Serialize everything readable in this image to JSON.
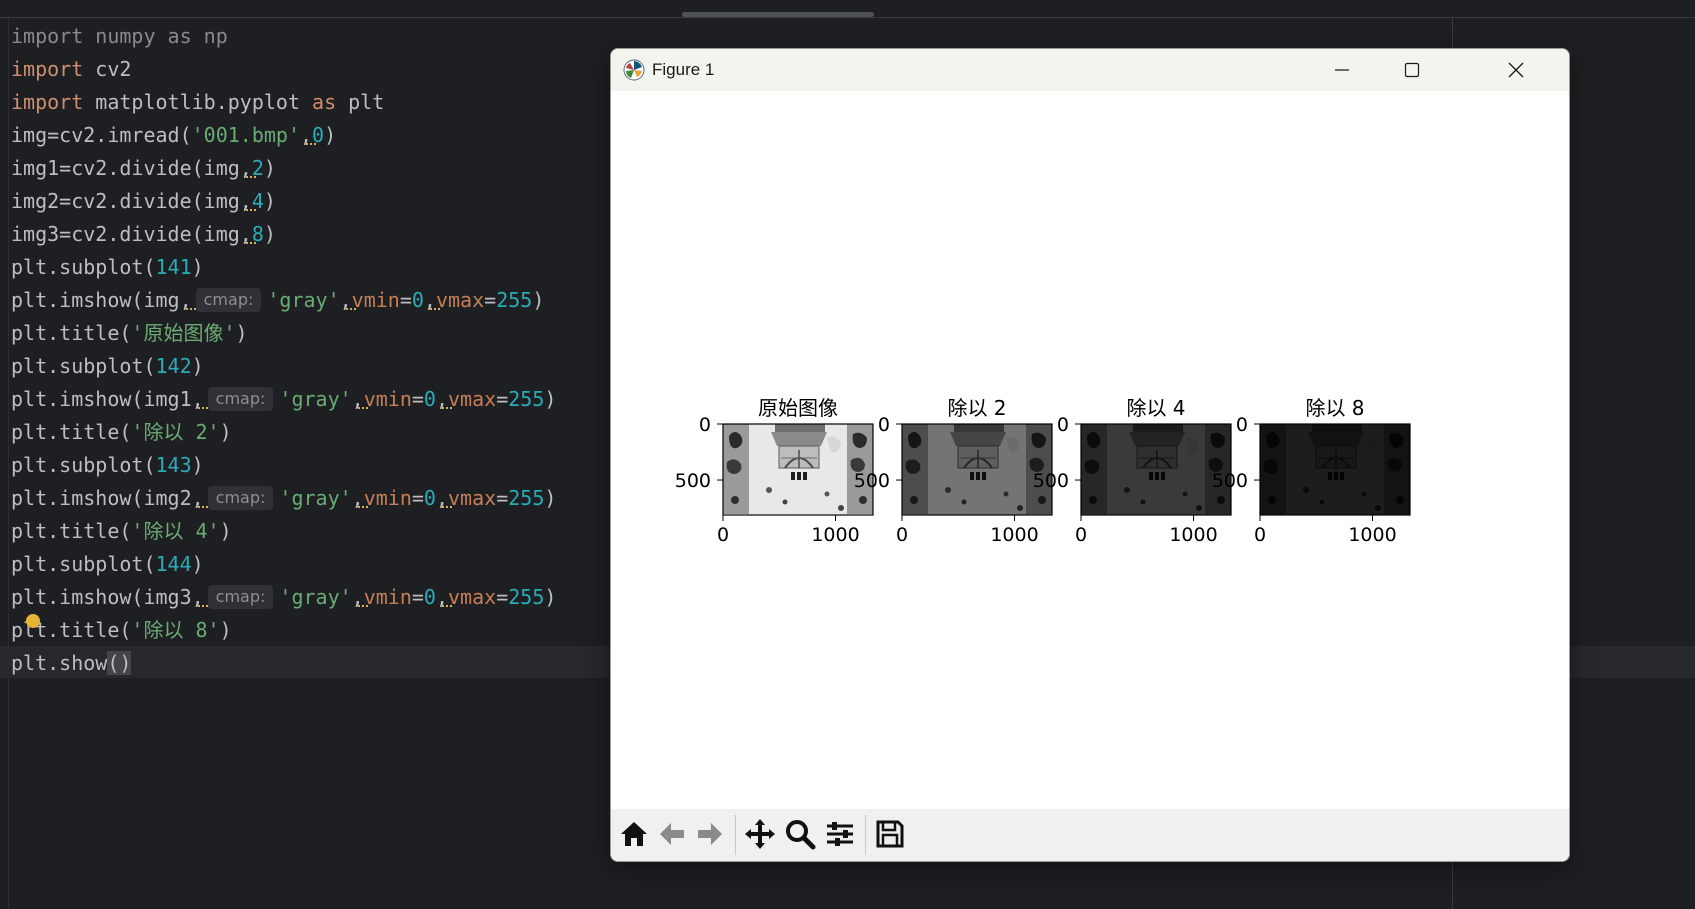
{
  "editor": {
    "lines": [
      [
        {
          "t": "import numpy as np",
          "c": "muted"
        }
      ],
      [
        {
          "t": "import",
          "c": "kw"
        },
        {
          "t": " cv2"
        }
      ],
      [
        {
          "t": "import",
          "c": "kw"
        },
        {
          "t": " matplotlib.pyplot "
        },
        {
          "t": "as",
          "c": "kw"
        },
        {
          "t": " plt"
        }
      ],
      [
        {
          "t": "img=cv2.imread("
        },
        {
          "t": "'001.bmp'",
          "c": "str"
        },
        {
          "t": ",",
          "c": "comma"
        },
        {
          "t": "0",
          "c": "num"
        },
        {
          "t": ")"
        }
      ],
      [
        {
          "t": "img1=cv2.divide(img"
        },
        {
          "t": ",",
          "c": "comma"
        },
        {
          "t": "2",
          "c": "num"
        },
        {
          "t": ")"
        }
      ],
      [
        {
          "t": "img2=cv2.divide(img"
        },
        {
          "t": ",",
          "c": "comma"
        },
        {
          "t": "4",
          "c": "num"
        },
        {
          "t": ")"
        }
      ],
      [
        {
          "t": "img3=cv2.divide(img"
        },
        {
          "t": ",",
          "c": "comma"
        },
        {
          "t": "8",
          "c": "num"
        },
        {
          "t": ")"
        }
      ],
      [
        {
          "t": "plt.subplot("
        },
        {
          "t": "141",
          "c": "num"
        },
        {
          "t": ")"
        }
      ],
      [
        {
          "t": "plt.imshow(img"
        },
        {
          "t": ",",
          "c": "comma"
        },
        {
          "t": "cmap:",
          "c": "hint"
        },
        {
          "t": "'gray'",
          "c": "str"
        },
        {
          "t": ",",
          "c": "comma"
        },
        {
          "t": "vmin",
          "c": "param"
        },
        {
          "t": "="
        },
        {
          "t": "0",
          "c": "num"
        },
        {
          "t": ",",
          "c": "comma"
        },
        {
          "t": "vmax",
          "c": "param"
        },
        {
          "t": "="
        },
        {
          "t": "255",
          "c": "num"
        },
        {
          "t": ")"
        }
      ],
      [
        {
          "t": "plt.title("
        },
        {
          "t": "'原始图像'",
          "c": "str"
        },
        {
          "t": ")"
        }
      ],
      [
        {
          "t": "plt.subplot("
        },
        {
          "t": "142",
          "c": "num"
        },
        {
          "t": ")"
        }
      ],
      [
        {
          "t": "plt.imshow(img1"
        },
        {
          "t": ",",
          "c": "comma"
        },
        {
          "t": "cmap:",
          "c": "hint"
        },
        {
          "t": "'gray'",
          "c": "str"
        },
        {
          "t": ",",
          "c": "comma"
        },
        {
          "t": "vmin",
          "c": "param"
        },
        {
          "t": "="
        },
        {
          "t": "0",
          "c": "num"
        },
        {
          "t": ",",
          "c": "comma"
        },
        {
          "t": "vmax",
          "c": "param"
        },
        {
          "t": "="
        },
        {
          "t": "255",
          "c": "num"
        },
        {
          "t": ")"
        }
      ],
      [
        {
          "t": "plt.title("
        },
        {
          "t": "'除以 2'",
          "c": "str"
        },
        {
          "t": ")"
        }
      ],
      [
        {
          "t": "plt.subplot("
        },
        {
          "t": "143",
          "c": "num"
        },
        {
          "t": ")"
        }
      ],
      [
        {
          "t": "plt.imshow(img2"
        },
        {
          "t": ",",
          "c": "comma"
        },
        {
          "t": "cmap:",
          "c": "hint"
        },
        {
          "t": "'gray'",
          "c": "str"
        },
        {
          "t": ",",
          "c": "comma"
        },
        {
          "t": "vmin",
          "c": "param"
        },
        {
          "t": "="
        },
        {
          "t": "0",
          "c": "num"
        },
        {
          "t": ",",
          "c": "comma"
        },
        {
          "t": "vmax",
          "c": "param"
        },
        {
          "t": "="
        },
        {
          "t": "255",
          "c": "num"
        },
        {
          "t": ")"
        }
      ],
      [
        {
          "t": "plt.title("
        },
        {
          "t": "'除以 4'",
          "c": "str"
        },
        {
          "t": ")"
        }
      ],
      [
        {
          "t": "plt.subplot("
        },
        {
          "t": "144",
          "c": "num"
        },
        {
          "t": ")"
        }
      ],
      [
        {
          "t": "plt.imshow(img3"
        },
        {
          "t": ",",
          "c": "comma"
        },
        {
          "t": "cmap:",
          "c": "hint"
        },
        {
          "t": "'gray'",
          "c": "str"
        },
        {
          "t": ",",
          "c": "comma"
        },
        {
          "t": "vmin",
          "c": "param"
        },
        {
          "t": "="
        },
        {
          "t": "0",
          "c": "num"
        },
        {
          "t": ",",
          "c": "comma"
        },
        {
          "t": "vmax",
          "c": "param"
        },
        {
          "t": "="
        },
        {
          "t": "255",
          "c": "num"
        },
        {
          "t": ")"
        }
      ],
      [
        {
          "t": "plt.title("
        },
        {
          "t": "'除以 8'",
          "c": "str"
        },
        {
          "t": ")"
        }
      ],
      [
        {
          "t": "plt.show"
        },
        {
          "t": "()",
          "c": "paren-hl"
        }
      ]
    ]
  },
  "figure_window": {
    "title": "Figure 1",
    "controls": {
      "minimize": "minimize",
      "maximize": "maximize",
      "close": "close"
    },
    "subplots": [
      {
        "title": "原始图像",
        "brightness": 1.0,
        "xticks": [
          "0",
          "1000"
        ],
        "yticks": [
          "0",
          "500"
        ]
      },
      {
        "title": "除以 2",
        "brightness": 0.5,
        "xticks": [
          "0",
          "1000"
        ],
        "yticks": [
          "0",
          "500"
        ]
      },
      {
        "title": "除以 4",
        "brightness": 0.25,
        "xticks": [
          "0",
          "1000"
        ],
        "yticks": [
          "0",
          "500"
        ]
      },
      {
        "title": "除以 8",
        "brightness": 0.125,
        "xticks": [
          "0",
          "1000"
        ],
        "yticks": [
          "0",
          "500"
        ]
      }
    ],
    "toolbar": [
      "home-icon",
      "back-icon",
      "forward-icon",
      "pan-icon",
      "zoom-icon",
      "configure-subplots-icon",
      "save-icon"
    ]
  },
  "colors": {
    "editor_bg": "#1e1f22",
    "keyword": "#cf8e6d",
    "string": "#6aab73",
    "number": "#2aacb8",
    "param": "#c77d55",
    "window_title_bg": "#f2f4ee",
    "toolbar_bg": "#f0f0f0"
  }
}
